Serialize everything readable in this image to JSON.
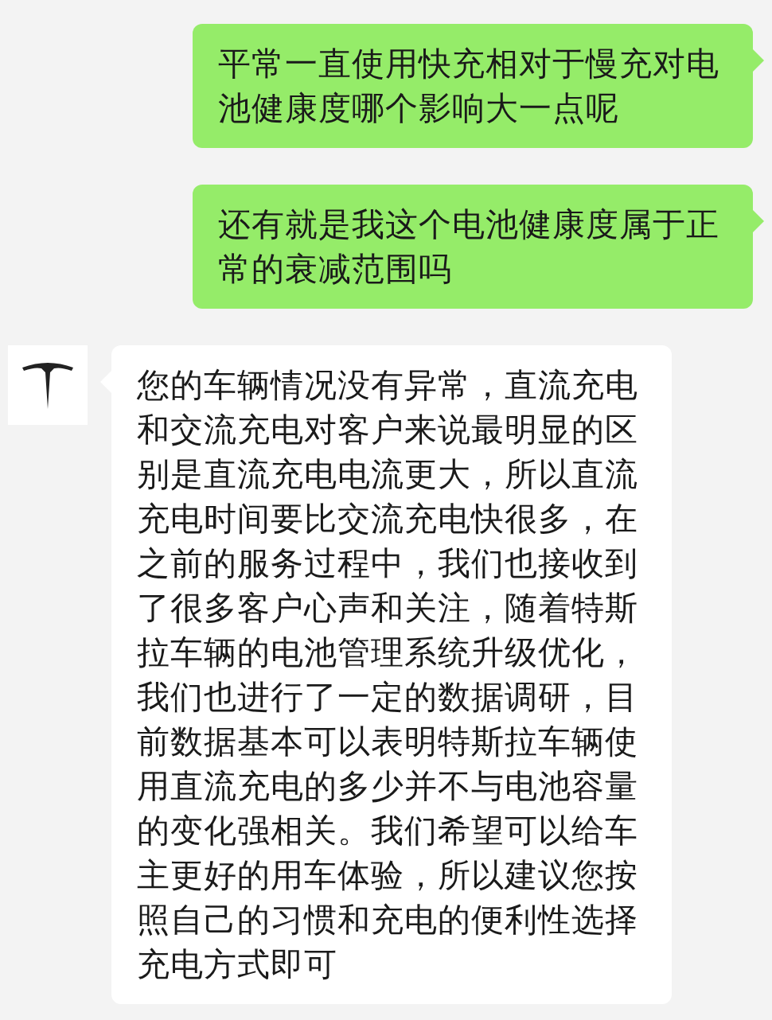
{
  "messages": [
    {
      "kind": "sent",
      "text": "平常一直使用快充相对于慢充对电池健康度哪个影响大一点呢"
    },
    {
      "kind": "sent",
      "text": "还有就是我这个电池健康度属于正常的衰减范围吗"
    },
    {
      "kind": "received",
      "text": "您的车辆情况没有异常，直流充电和交流充电对客户来说最明显的区别是直流充电电流更大，所以直流充电时间要比交流充电快很多，在之前的服务过程中，我们也接收到了很多客户心声和关注，随着特斯拉车辆的电池管理系统升级优化，我们也进行了一定的数据调研，目前数据基本可以表明特斯拉车辆使用直流充电的多少并不与电池容量的变化强相关。我们希望可以给车主更好的用车体验，所以建议您按照自己的习惯和充电的便利性选择充电方式即可"
    }
  ]
}
